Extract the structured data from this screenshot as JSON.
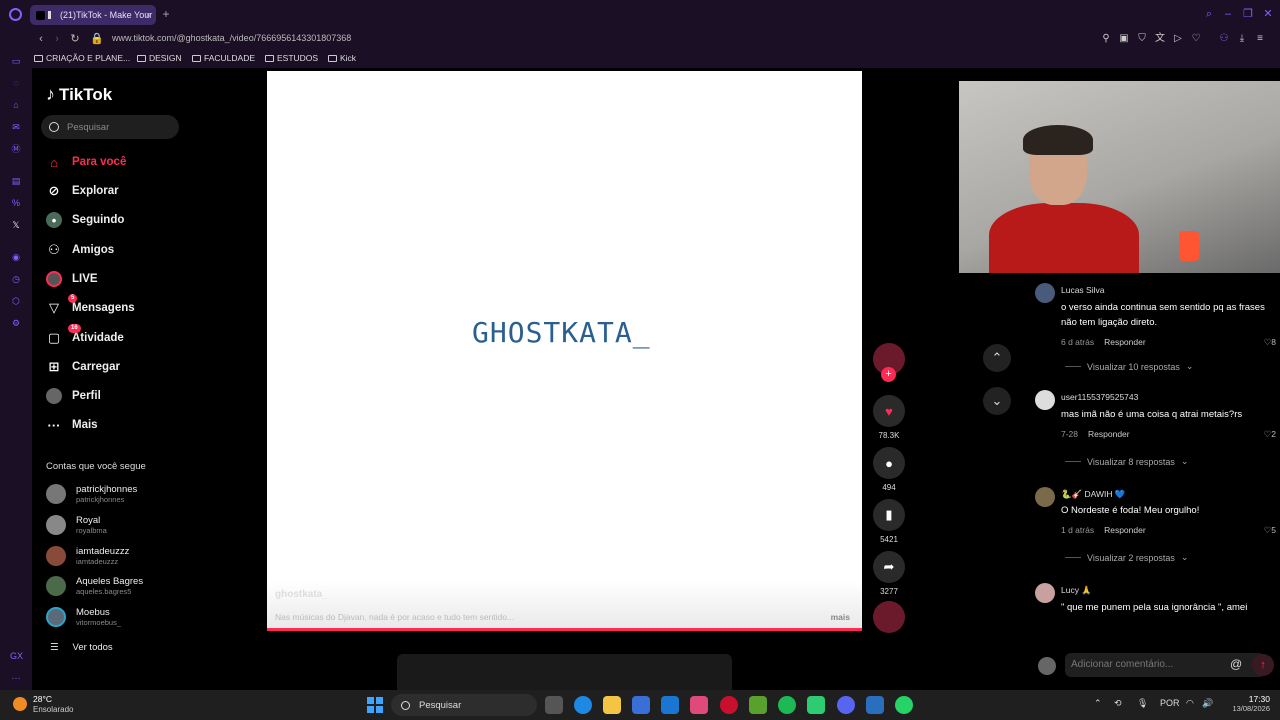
{
  "browser": {
    "tab_title": "(21)TikTok - Make Your",
    "tab_close": "×",
    "new_tab": "+",
    "url": "www.tiktok.com/@ghostkata_/video/7666956143301807368",
    "accent": "#8a5cff",
    "bookmarks": [
      {
        "label": "CRIAÇÃO E PLANE..."
      },
      {
        "label": "DESIGN"
      },
      {
        "label": "FACULDADE"
      },
      {
        "label": "ESTUDOS"
      },
      {
        "label": "Kick"
      }
    ]
  },
  "tiktok": {
    "logo": "TikTok",
    "search_placeholder": "Pesquisar",
    "brand_color": "#fe2c55",
    "nav": [
      {
        "label": "Para você",
        "icon": "home-icon",
        "active": true
      },
      {
        "label": "Explorar",
        "icon": "compass-icon"
      },
      {
        "label": "Seguindo",
        "icon": "following-avatar-icon"
      },
      {
        "label": "Amigos",
        "icon": "friends-icon"
      },
      {
        "label": "LIVE",
        "icon": "live-icon"
      },
      {
        "label": "Mensagens",
        "icon": "messages-icon",
        "badge": "5"
      },
      {
        "label": "Atividade",
        "icon": "activity-icon",
        "badge": "16"
      },
      {
        "label": "Carregar",
        "icon": "upload-icon"
      },
      {
        "label": "Perfil",
        "icon": "profile-avatar-icon"
      },
      {
        "label": "Mais",
        "icon": "more-icon"
      }
    ],
    "following_title": "Contas que você segue",
    "following": [
      {
        "name": "patrickjhonnes",
        "handle": "patrickjhonnes"
      },
      {
        "name": "Royal",
        "handle": "royalbma"
      },
      {
        "name": "iamtadeuzzz",
        "handle": "iamtadeuzzz"
      },
      {
        "name": "Aqueles Bagres",
        "handle": "aqueles.bagres5"
      },
      {
        "name": "Moebus",
        "handle": "vitormoebus_"
      }
    ],
    "see_all": "Ver todos"
  },
  "video": {
    "overlay_text": "GHOSTKATA_",
    "author": "ghostkata_",
    "description": "Nas músicas do Djavan, nada é por acaso e tudo tem sentido...",
    "more": "mais",
    "likes": "78.3K",
    "comments": "494",
    "saves": "5421",
    "shares": "3277"
  },
  "comments": [
    {
      "user": "Lucas Silva",
      "text": "o verso ainda continua sem sentido pq as frases não tem ligação direto.",
      "time": "6 d atrás",
      "reply": "Responder",
      "likes": "8",
      "replies": "Visualizar 10 respostas"
    },
    {
      "user": "user1155379525743",
      "text": "mas imã não é uma coisa q atrai metais?rs",
      "time": "7-28",
      "reply": "Responder",
      "likes": "2",
      "replies": "Visualizar 8 respostas"
    },
    {
      "user": "🐍🎸 DAWIH 💙",
      "text": "O Nordeste é foda! Meu orgulho!",
      "time": "1 d atrás",
      "reply": "Responder",
      "likes": "5",
      "replies": "Visualizar 2 respostas"
    },
    {
      "user": "Lucy 🙏",
      "text": "\" que me punem pela sua ignorância \", amei"
    }
  ],
  "comment_input_placeholder": "Adicionar comentário...",
  "taskbar": {
    "temperature": "28°C",
    "condition": "Ensolarado",
    "search": "Pesquisar",
    "lang": "POR",
    "time": "17:30",
    "date": "13/08/2026"
  }
}
